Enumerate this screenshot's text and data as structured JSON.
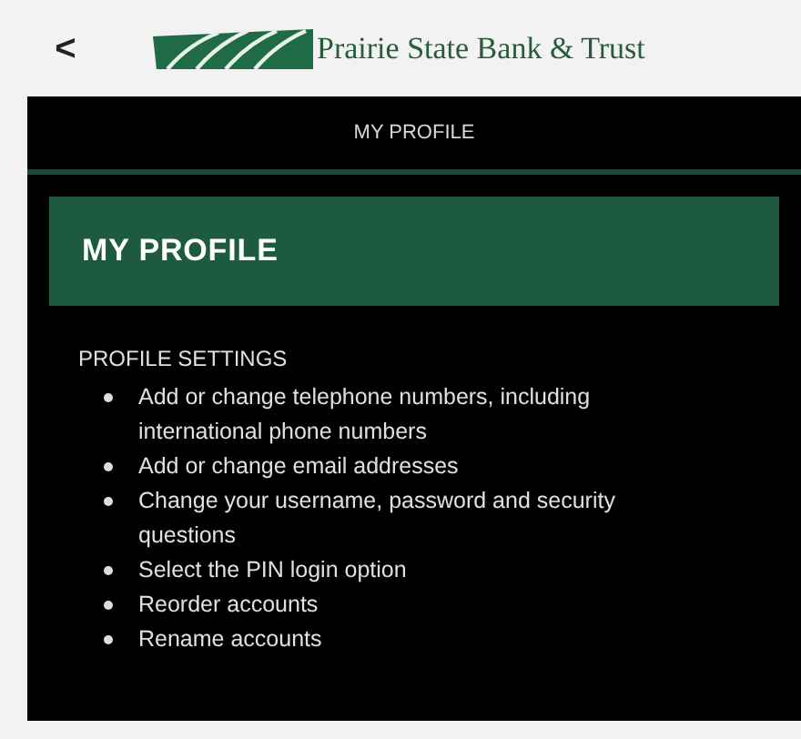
{
  "header": {
    "back": "<",
    "bank_name": "Prairie State Bank & Trust"
  },
  "nav_title": "MY PROFILE",
  "card": {
    "title": "MY PROFILE"
  },
  "section": {
    "heading": "PROFILE SETTINGS",
    "items": [
      "Add or change telephone numbers, including international phone numbers",
      "Add or change email addresses",
      "Change your username, password and security questions",
      "Select the PIN login option",
      "Reorder accounts",
      "Rename accounts"
    ]
  }
}
